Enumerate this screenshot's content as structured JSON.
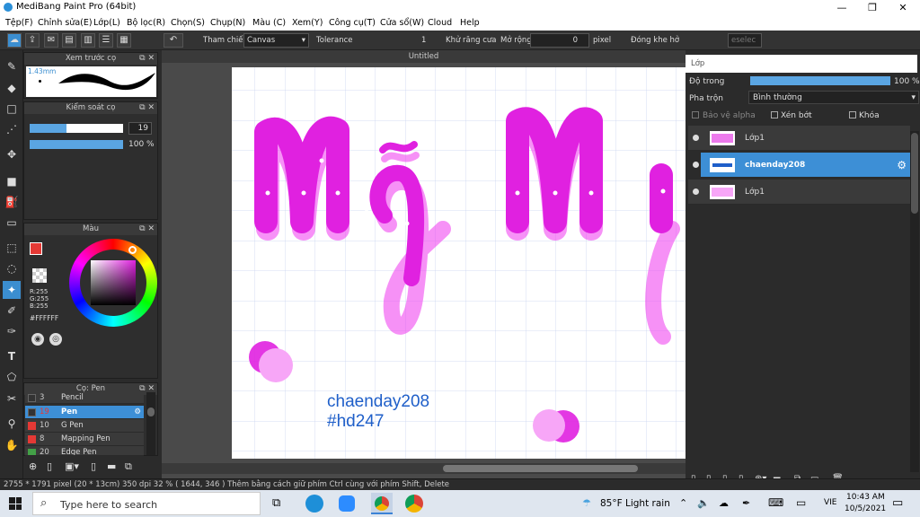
{
  "window": {
    "title": "MediBang Paint Pro (64bit)",
    "minimize": "—",
    "maximize": "❐",
    "close": "✕"
  },
  "menu": [
    "Tệp(F)",
    "Chỉnh sửa(E)",
    "Lớp(L)",
    "Bộ lọc(R)",
    "Chọn(S)",
    "Chụp(N)",
    "Màu (C)",
    "Xem(Y)",
    "Công cụ(T)",
    "Cửa sổ(W)",
    "Cloud",
    "Help"
  ],
  "toolbar": {
    "reference_label": "Tham chiếu",
    "reference_value": "Canvas",
    "tolerance_label": "Tolerance",
    "tolerance_value": "1",
    "antialias_label": "Khử răng cưa",
    "expand_label": "Mở rộng",
    "expand_value": "0",
    "expand_unit": "pixel",
    "close_gap_label": "Đóng khe hở",
    "deselect_label": "eselec"
  },
  "preview_panel": {
    "title": "Xem trước cọ",
    "size": "1.43mm"
  },
  "brush_control": {
    "title": "Kiểm soát cọ",
    "size": "19",
    "opacity": "100 %"
  },
  "color_panel": {
    "title": "Màu",
    "r": "R:255",
    "g": "G:255",
    "b": "B:255",
    "hex": "#FFFFFF"
  },
  "brush_panel": {
    "title": "Cọ: Pen",
    "items": [
      {
        "size": "3",
        "name": "Pencil",
        "color": "#333333"
      },
      {
        "size": "19",
        "name": "Pen",
        "color": "#333333",
        "selected": true
      },
      {
        "size": "10",
        "name": "G Pen",
        "color": "#e53935"
      },
      {
        "size": "8",
        "name": "Mapping Pen",
        "color": "#e53935"
      },
      {
        "size": "20",
        "name": "Edge Pen",
        "color": "#43a047"
      }
    ]
  },
  "canvas": {
    "tab": "Untitled",
    "signature_line1": "chaenday208",
    "signature_line2": "#hd247"
  },
  "layer_panel": {
    "title": "Lớp",
    "opacity_label": "Độ trong",
    "opacity_value": "100 %",
    "blend_label": "Pha trộn",
    "blend_value": "Bình thường",
    "protect_alpha": "Bảo vệ alpha",
    "clipping": "Xén bớt",
    "lock": "Khóa",
    "layers": [
      {
        "name": "Lớp1",
        "selected": false
      },
      {
        "name": "chaenday208",
        "selected": true
      },
      {
        "name": "Lớp1",
        "selected": false
      }
    ]
  },
  "status": {
    "text": "2755 * 1791 pixel  (20 * 13cm)  350 dpi  32 %  ( 1644, 346 )  Thêm bằng cách giữ phím Ctrl cùng với phím Shift, Delete"
  },
  "taskbar": {
    "search_placeholder": "Type here to search",
    "weather": "85°F  Light rain",
    "lang": "VIE",
    "time": "10:43 AM",
    "date": "10/5/2021"
  },
  "colors": {
    "accent": "#3d8fd6",
    "ink": "#e021e0",
    "ink_light": "#f38ef3"
  }
}
